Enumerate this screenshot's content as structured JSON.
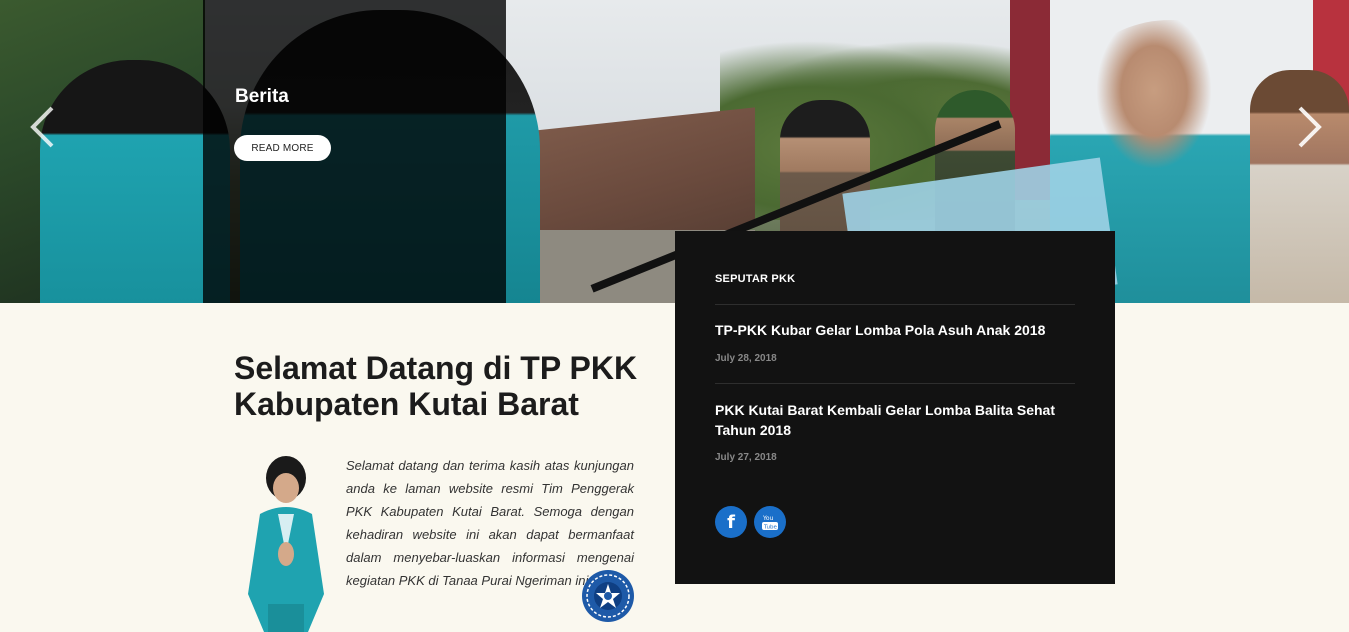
{
  "slider": {
    "caption": "Berita",
    "read_more_label": "READ MORE"
  },
  "welcome": {
    "title": "Selamat Datang di TP PKK Kabupaten Kutai Barat",
    "text": "Selamat datang dan terima kasih atas kunjungan anda ke laman website resmi Tim Penggerak PKK Kabupaten Kutai Barat. Semoga dengan kehadiran website ini akan dapat bermanfaat dalam menyebar-luaskan informasi mengenai kegiatan PKK di Tanaa Purai Ngeriman ini"
  },
  "news": {
    "heading": "SEPUTAR PKK",
    "items": [
      {
        "title": "TP-PKK Kubar Gelar Lomba Pola Asuh Anak 2018",
        "date": "July 28, 2018"
      },
      {
        "title": "PKK Kutai Barat Kembali Gelar Lomba Balita Sehat Tahun 2018",
        "date": "July 27, 2018"
      }
    ],
    "social": [
      "facebook-icon",
      "youtube-icon"
    ]
  },
  "colors": {
    "panel_bg": "#121212",
    "page_bg": "#faf8ef",
    "social_blue": "#1a6fc9",
    "uniform_teal": "#1fa3b0"
  }
}
